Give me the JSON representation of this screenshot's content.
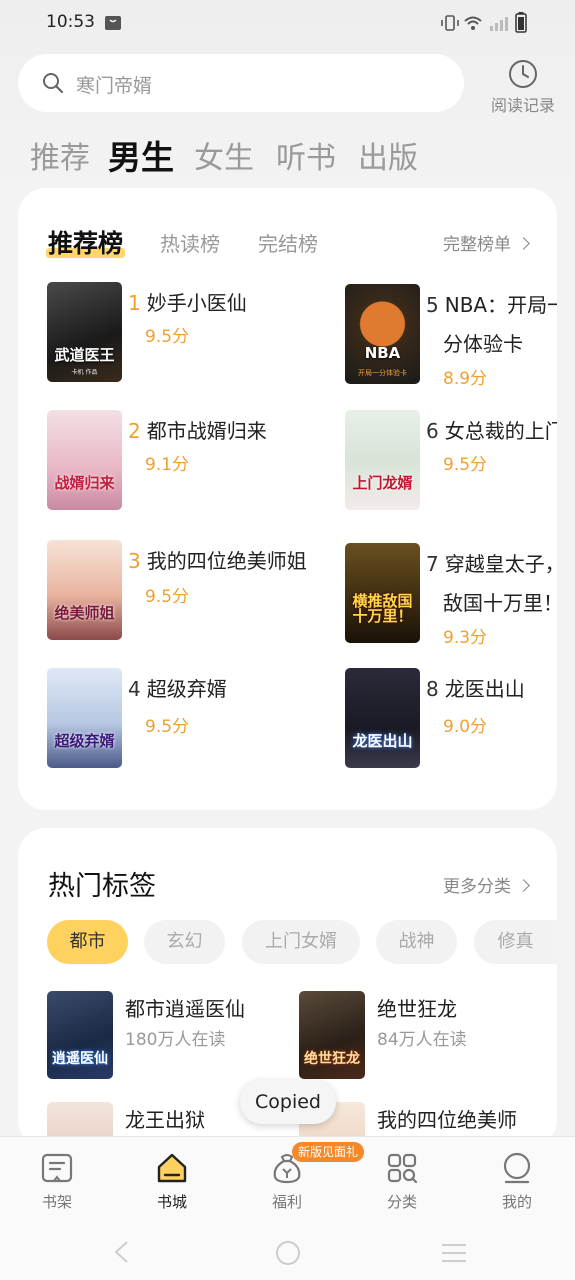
{
  "status_bar": {
    "time": "10:53"
  },
  "search": {
    "placeholder": "寒门帝婿",
    "history_label": "阅读记录"
  },
  "category_tabs": [
    {
      "label": "推荐",
      "active": false
    },
    {
      "label": "男生",
      "active": true
    },
    {
      "label": "女生",
      "active": false
    },
    {
      "label": "听书",
      "active": false
    },
    {
      "label": "出版",
      "active": false
    }
  ],
  "ranking": {
    "tabs": [
      {
        "label": "推荐榜",
        "active": true
      },
      {
        "label": "热读榜",
        "active": false
      },
      {
        "label": "完结榜",
        "active": false
      }
    ],
    "more_label": "完整榜单",
    "books": [
      {
        "rank": "1",
        "title": "妙手小医仙",
        "title_line2": "",
        "score": "9.5分",
        "cover_text": "武道医王",
        "cover_sub": "卡机 作品"
      },
      {
        "rank": "2",
        "title": "都市战婿归来",
        "title_line2": "",
        "score": "9.1分",
        "cover_text": "战婿归来",
        "cover_sub": ""
      },
      {
        "rank": "3",
        "title": "我的四位绝美师姐",
        "title_line2": "",
        "score": "9.5分",
        "cover_text": "绝美师姐",
        "cover_sub": ""
      },
      {
        "rank": "4",
        "title": "超级弃婿",
        "title_line2": "",
        "score": "9.5分",
        "cover_text": "超级弃婿",
        "cover_sub": ""
      },
      {
        "rank": "5",
        "title": "NBA：开局一",
        "title_line2": "分体验卡",
        "score": "8.9分",
        "cover_text": "NBA",
        "cover_sub": "开局一分体验卡"
      },
      {
        "rank": "6",
        "title": "女总裁的上门",
        "title_line2": "",
        "score": "9.5分",
        "cover_text": "上门龙婿",
        "cover_sub": ""
      },
      {
        "rank": "7",
        "title": "穿越皇太子，",
        "title_line2": "敌国十万里！",
        "score": "9.3分",
        "cover_text": "横推敌国十万里！",
        "cover_sub": ""
      },
      {
        "rank": "8",
        "title": "龙医出山",
        "title_line2": "",
        "score": "9.0分",
        "cover_text": "龙医出山",
        "cover_sub": ""
      }
    ]
  },
  "hot_tags": {
    "title": "热门标签",
    "more_label": "更多分类",
    "chips": [
      {
        "label": "都市",
        "active": true
      },
      {
        "label": "玄幻",
        "active": false
      },
      {
        "label": "上门女婿",
        "active": false
      },
      {
        "label": "战神",
        "active": false
      },
      {
        "label": "修真",
        "active": false
      }
    ],
    "books": [
      {
        "title": "都市逍遥医仙",
        "readers": "180万人在读",
        "cover_text": "逍遥医仙"
      },
      {
        "title": "绝世狂龙",
        "readers": "84万人在读",
        "cover_text": "绝世狂龙"
      },
      {
        "title": "龙王出狱",
        "readers": "",
        "cover_text": ""
      },
      {
        "title": "我的四位绝美师",
        "readers": "",
        "cover_text": ""
      }
    ]
  },
  "toast": "Copied",
  "bottom_nav": {
    "items": [
      {
        "label": "书架",
        "icon": "bookshelf-icon",
        "active": false
      },
      {
        "label": "书城",
        "icon": "bookstore-icon",
        "active": true
      },
      {
        "label": "福利",
        "icon": "welfare-bag-icon",
        "active": false
      },
      {
        "label": "分类",
        "icon": "category-grid-icon",
        "active": false
      },
      {
        "label": "我的",
        "icon": "profile-icon",
        "active": false
      }
    ],
    "badge": "新版见面礼"
  },
  "colors": {
    "accent": "#f0a030",
    "chip_active": "#ffd25f",
    "highlight": "#ffd66a",
    "badge": "#f5892a"
  }
}
